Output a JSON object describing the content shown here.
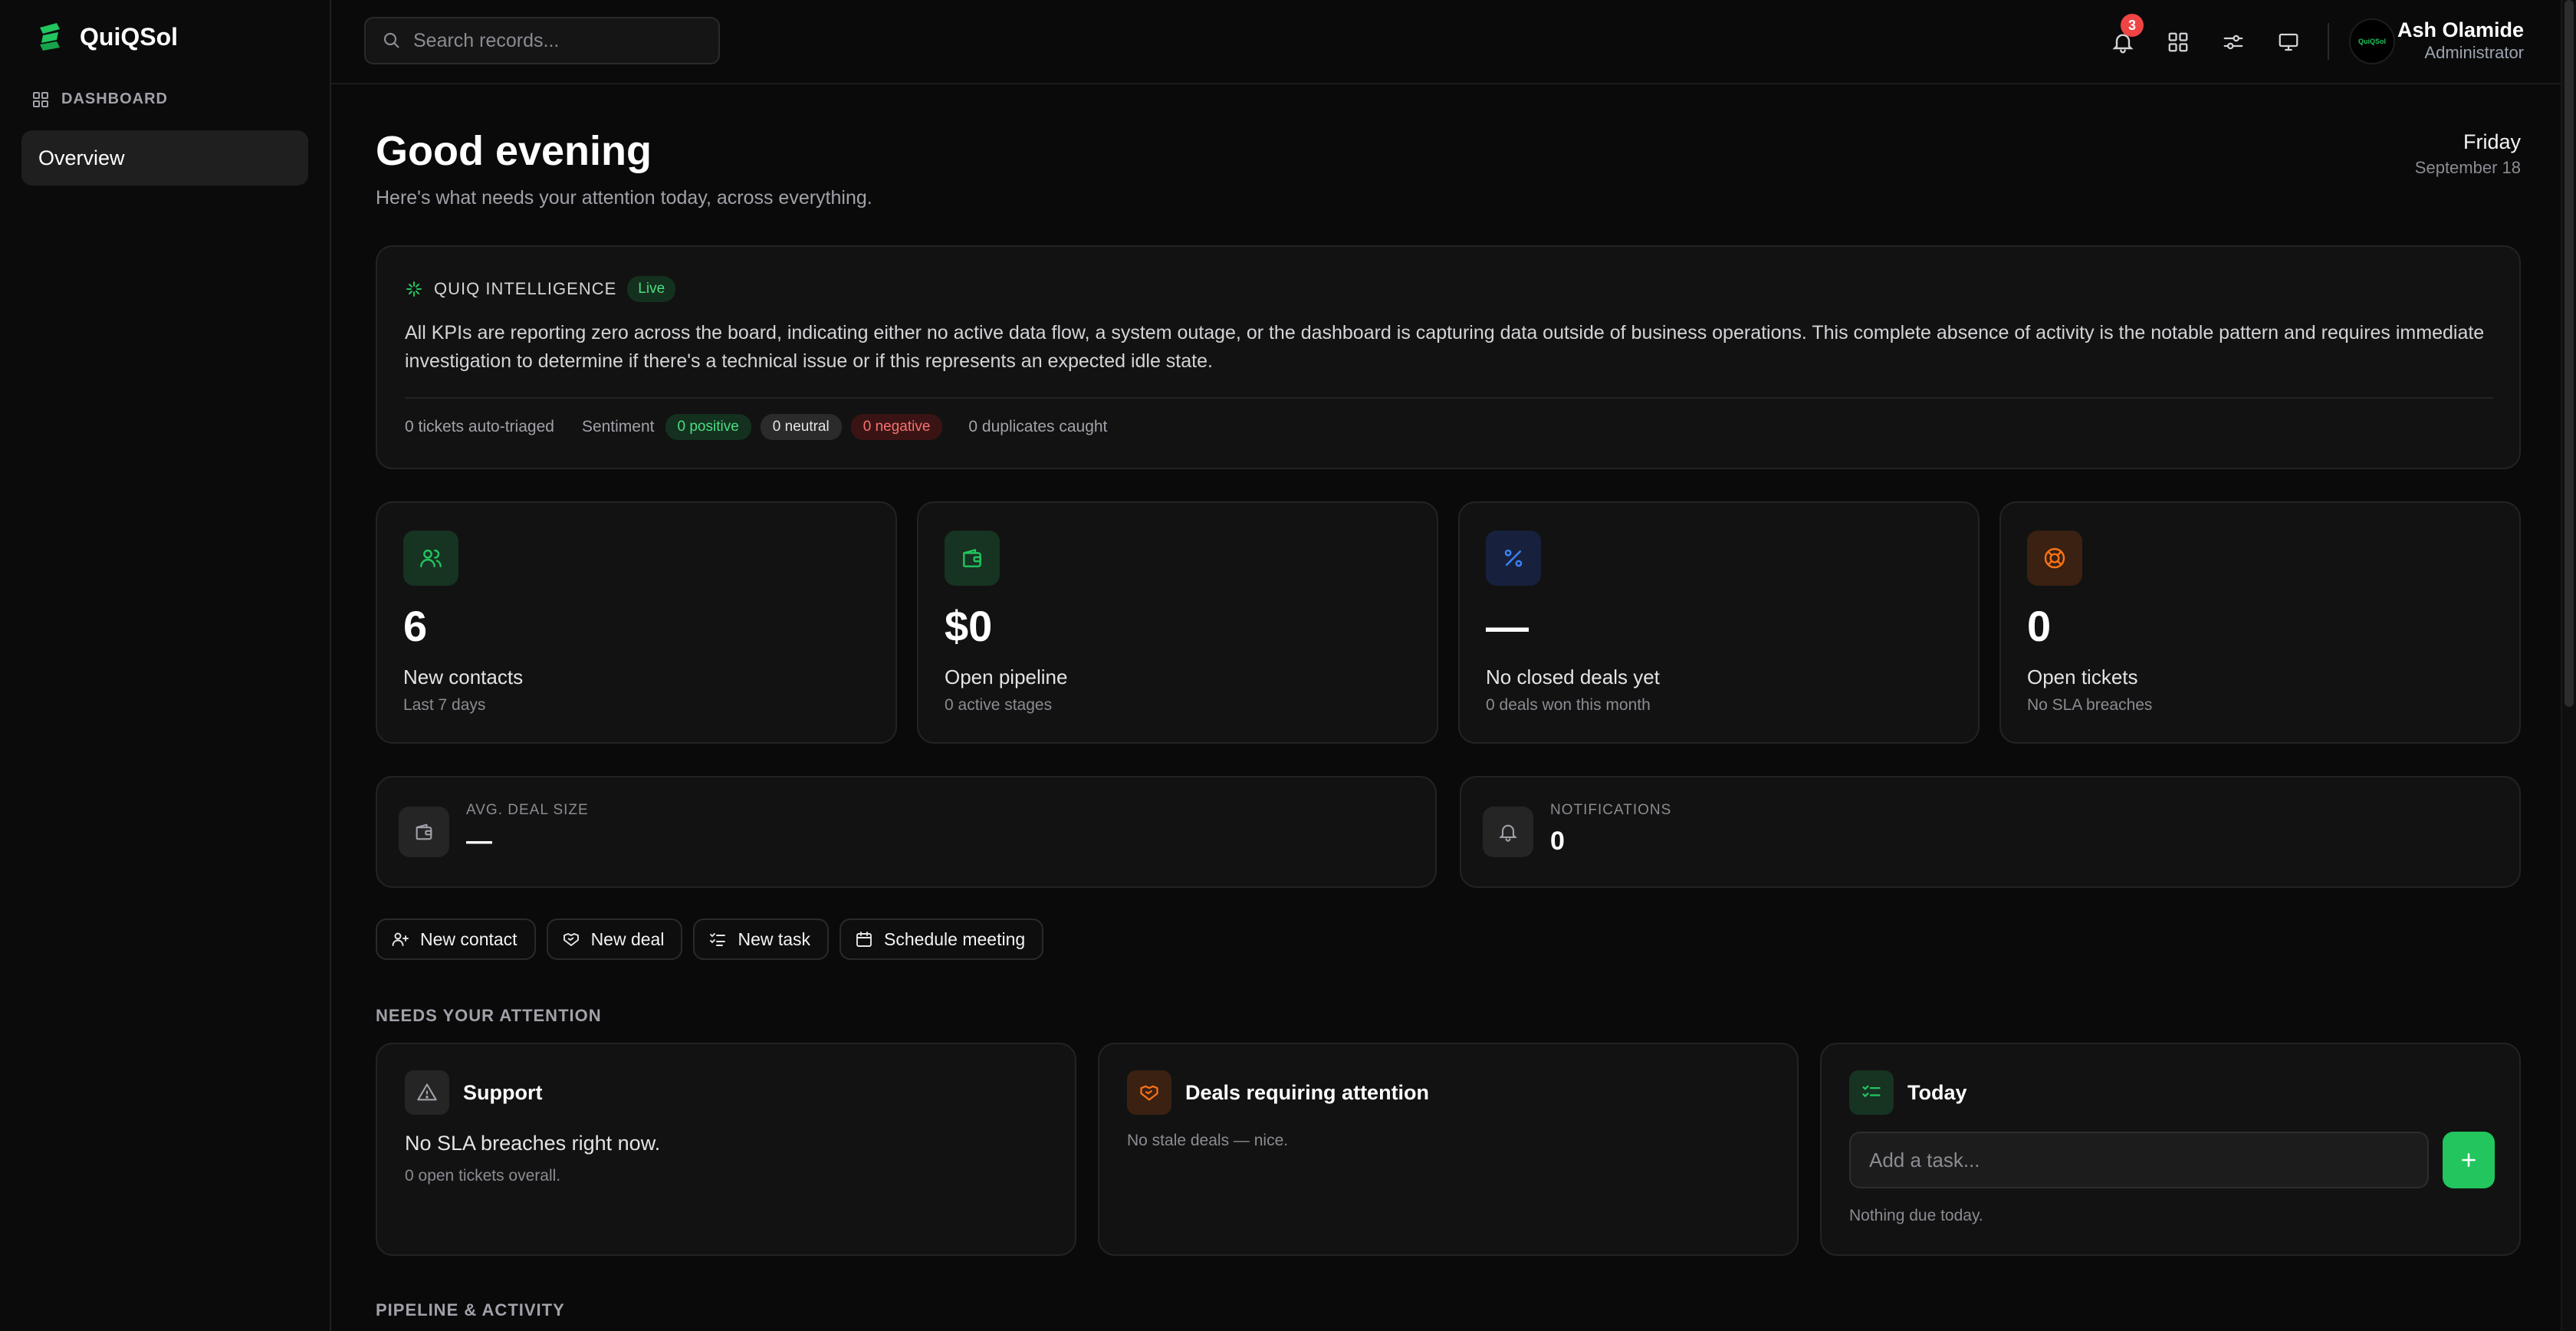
{
  "sidebar": {
    "brand": "QuiQSol",
    "section_label": "DASHBOARD",
    "items": [
      {
        "label": "Overview",
        "active": true
      }
    ]
  },
  "topbar": {
    "search_placeholder": "Search records...",
    "notification_count": "3",
    "user": {
      "name": "Ash Olamide",
      "role": "Administrator",
      "avatar_text": "QuiQSol"
    }
  },
  "header": {
    "greeting": "Good evening",
    "subtitle": "Here's what needs your attention today, across everything.",
    "day": "Friday",
    "date": "September 18"
  },
  "intelligence": {
    "title": "QUIQ INTELLIGENCE",
    "status": "Live",
    "summary": "All KPIs are reporting zero across the board, indicating either no active data flow, a system outage, or the dashboard is capturing data outside of business operations. This complete absence of activity is the notable pattern and requires immediate investigation to determine if there's a technical issue or if this represents an expected idle state.",
    "auto_triaged": "0 tickets auto-triaged",
    "sentiment_label": "Sentiment",
    "positive": "0 positive",
    "neutral": "0 neutral",
    "negative": "0 negative",
    "duplicates": "0 duplicates caught"
  },
  "kpis": [
    {
      "icon": "users-icon",
      "value": "6",
      "label": "New contacts",
      "sub": "Last 7 days",
      "color": "#22c55e"
    },
    {
      "icon": "wallet-icon",
      "value": "$0",
      "label": "Open pipeline",
      "sub": "0 active stages",
      "color": "#22c55e"
    },
    {
      "icon": "percent-icon",
      "value": "—",
      "label": "No closed deals yet",
      "sub": "0 deals won this month",
      "color": "#3b82f6"
    },
    {
      "icon": "lifebuoy-icon",
      "value": "0",
      "label": "Open tickets",
      "sub": "No SLA breaches",
      "color": "#f97316"
    }
  ],
  "mini_stats": [
    {
      "icon": "wallet-icon",
      "label": "AVG. DEAL SIZE",
      "value": "—"
    },
    {
      "icon": "bell-icon",
      "label": "NOTIFICATIONS",
      "value": "0"
    }
  ],
  "actions": [
    {
      "icon": "user-plus-icon",
      "label": "New contact"
    },
    {
      "icon": "handshake-icon",
      "label": "New deal"
    },
    {
      "icon": "checklist-icon",
      "label": "New task"
    },
    {
      "icon": "calendar-icon",
      "label": "Schedule meeting"
    }
  ],
  "attention": {
    "title": "NEEDS YOUR ATTENTION",
    "support": {
      "title": "Support",
      "message": "No SLA breaches right now.",
      "sub": "0 open tickets overall."
    },
    "deals": {
      "title": "Deals requiring attention",
      "message": "No stale deals — nice."
    },
    "today": {
      "title": "Today",
      "placeholder": "Add a task...",
      "empty": "Nothing due today."
    }
  },
  "pipeline_title": "PIPELINE & ACTIVITY",
  "colors": {
    "accent": "#22c55e",
    "blue": "#3b82f6",
    "orange": "#f97316",
    "danger": "#ef4444"
  }
}
